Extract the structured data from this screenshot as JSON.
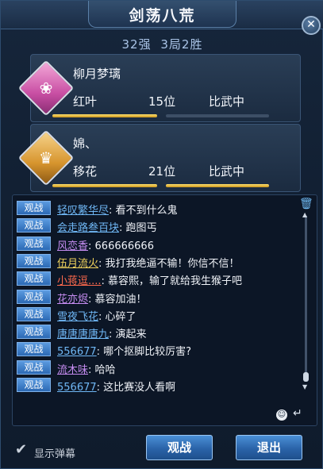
{
  "window": {
    "title": "剑荡八荒"
  },
  "record": {
    "stage": "32强",
    "score": "3局2胜"
  },
  "players": [
    {
      "name": "柳月梦璃",
      "school": "红叶",
      "rank": "15位",
      "status": "比武中",
      "bar1": 1.0,
      "bar2": 0.0
    },
    {
      "name": "婂、",
      "school": "移花",
      "rank": "21位",
      "status": "比武中",
      "bar1": 1.0,
      "bar2": 1.0
    }
  ],
  "chat": {
    "badge_label": "观战",
    "messages": [
      {
        "user": "轻叹繁华尽",
        "text": ": 看不到什么鬼",
        "color": "#6fb7f5"
      },
      {
        "user": "会走路叁百块",
        "text": ": 跑图丐",
        "color": "#6fb7f5"
      },
      {
        "user": "风恋香",
        "text": ": 666666666",
        "color": "#c58cf0"
      },
      {
        "user": "伍月流火",
        "text": ": 我打我绝逼不输！你信不信！",
        "color": "#f0d25c"
      },
      {
        "user": "小蒋逗....",
        "text": ": 慕容熙，输了就给我生猴子吧",
        "color": "#ff6a4d"
      },
      {
        "user": "花亦烬",
        "text": ": 慕容加油！",
        "color": "#c58cf0"
      },
      {
        "user": "雪夜飞花",
        "text": ": 心碎了",
        "color": "#6fb7f5"
      },
      {
        "user": "唐唐唐唐九",
        "text": ": 演起来",
        "color": "#6fb7f5"
      },
      {
        "user": "556677",
        "text": ": 哪个抠脚比较厉害?",
        "color": "#6fb7f5"
      },
      {
        "user": "流木味",
        "text": ": 哈哈",
        "color": "#c58cf0"
      },
      {
        "user": "556677",
        "text": ": 这比赛没人看啊",
        "color": "#6fb7f5"
      }
    ]
  },
  "footer": {
    "toggle_label": "显示弹幕",
    "watch_label": "观战",
    "exit_label": "退出"
  }
}
